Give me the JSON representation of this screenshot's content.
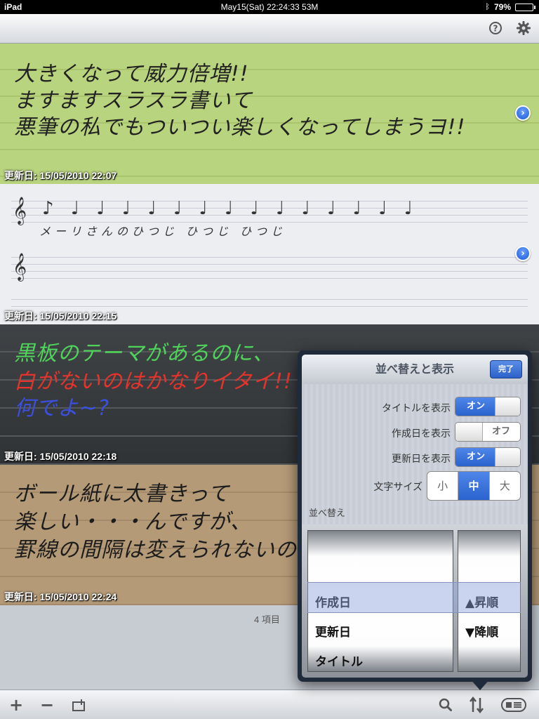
{
  "status": {
    "device": "iPad",
    "datetime": "May15(Sat) 22:24:33 53M",
    "battery": "79%"
  },
  "toolbar": {
    "help_icon": "help-icon",
    "settings_icon": "gear-icon"
  },
  "notes": [
    {
      "stamp": "更新日: 15/05/2010 22:07",
      "lines": [
        "大きくなって威力倍増!!",
        "ますますスラスラ書いて",
        "悪筆の私でもついつい楽しくなってしまうヨ!!"
      ]
    },
    {
      "stamp": "更新日: 15/05/2010 22:15",
      "lines": [
        "メーリさんのひつじ ひつじ ひつじ"
      ]
    },
    {
      "stamp": "更新日: 15/05/2010 22:18",
      "lines": [
        "黒板のテーマがあるのに、",
        "白がないのはかなりイタイ!!フ~く",
        "何でよ~?"
      ],
      "colors": [
        "#4fd35a",
        "#e8332c",
        "#3b4fe0"
      ]
    },
    {
      "stamp": "更新日: 15/05/2010 22:24",
      "lines": [
        "ボール紙に太書きって",
        "楽しい・・・んですが、",
        "罫線の間隔は変えられないので"
      ]
    }
  ],
  "count": "4 項目",
  "popover": {
    "title": "並べ替えと表示",
    "done": "完了",
    "rows": [
      {
        "label": "タイトルを表示",
        "state": "オン"
      },
      {
        "label": "作成日を表示",
        "state": "オフ"
      },
      {
        "label": "更新日を表示",
        "state": "オン"
      }
    ],
    "font_size_label": "文字サイズ",
    "font_sizes": [
      "小",
      "中",
      "大"
    ],
    "sort_label": "並べ替え",
    "sort_fields": [
      "作成日",
      "更新日",
      "タイトル"
    ],
    "sort_orders": [
      "▲昇順",
      "▼降順"
    ]
  }
}
